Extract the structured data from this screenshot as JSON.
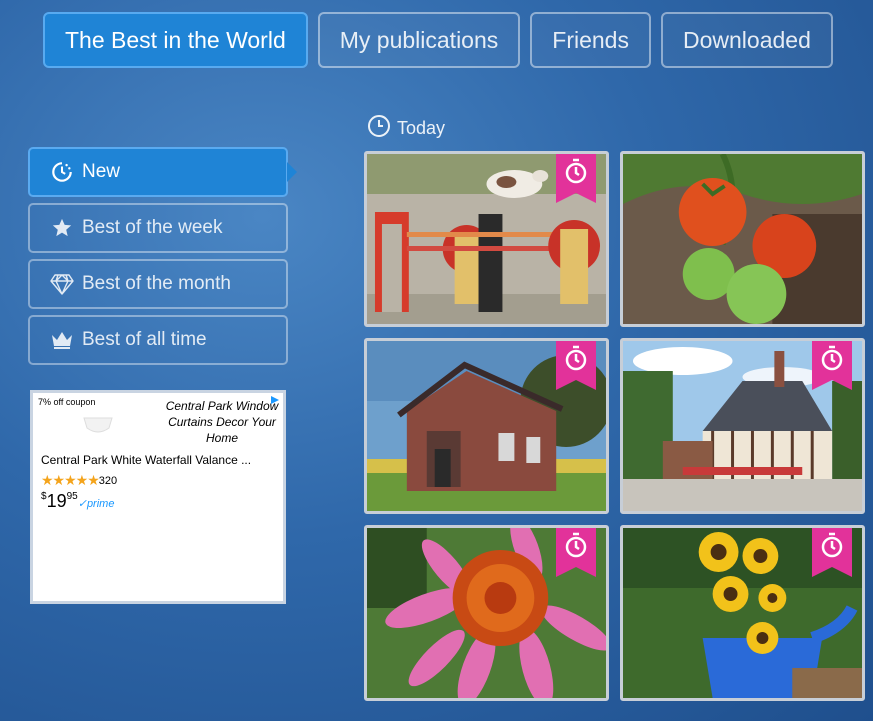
{
  "tabs": [
    {
      "label": "The Best in the World",
      "active": true
    },
    {
      "label": "My publications",
      "active": false
    },
    {
      "label": "Friends",
      "active": false
    },
    {
      "label": "Downloaded",
      "active": false
    }
  ],
  "sidebar": {
    "items": [
      {
        "label": "New",
        "icon": "clock-new-icon",
        "active": true
      },
      {
        "label": "Best of the week",
        "icon": "star-icon",
        "active": false
      },
      {
        "label": "Best of the month",
        "icon": "diamond-icon",
        "active": false
      },
      {
        "label": "Best of all time",
        "icon": "crown-icon",
        "active": false
      }
    ]
  },
  "ad": {
    "coupon": "7% off coupon",
    "title": "Central Park Window Curtains Decor Your Home",
    "product": "Central Park White Waterfall Valance ...",
    "rating_count": "320",
    "price_dollars": "19",
    "price_cents": "95",
    "prime": "prime"
  },
  "section": {
    "label": "Today",
    "icon": "clock-icon"
  },
  "photos": [
    {
      "subject": "rabbit jumping over fence",
      "timer": true
    },
    {
      "subject": "tomatoes on vine",
      "timer": false
    },
    {
      "subject": "old brick schoolhouse",
      "timer": true
    },
    {
      "subject": "half-timbered house",
      "timer": true
    },
    {
      "subject": "pink coneflower",
      "timer": true
    },
    {
      "subject": "sunflowers and watering can",
      "timer": true
    }
  ],
  "colors": {
    "accent": "#1f84d6",
    "bookmark": "#e2329a"
  }
}
